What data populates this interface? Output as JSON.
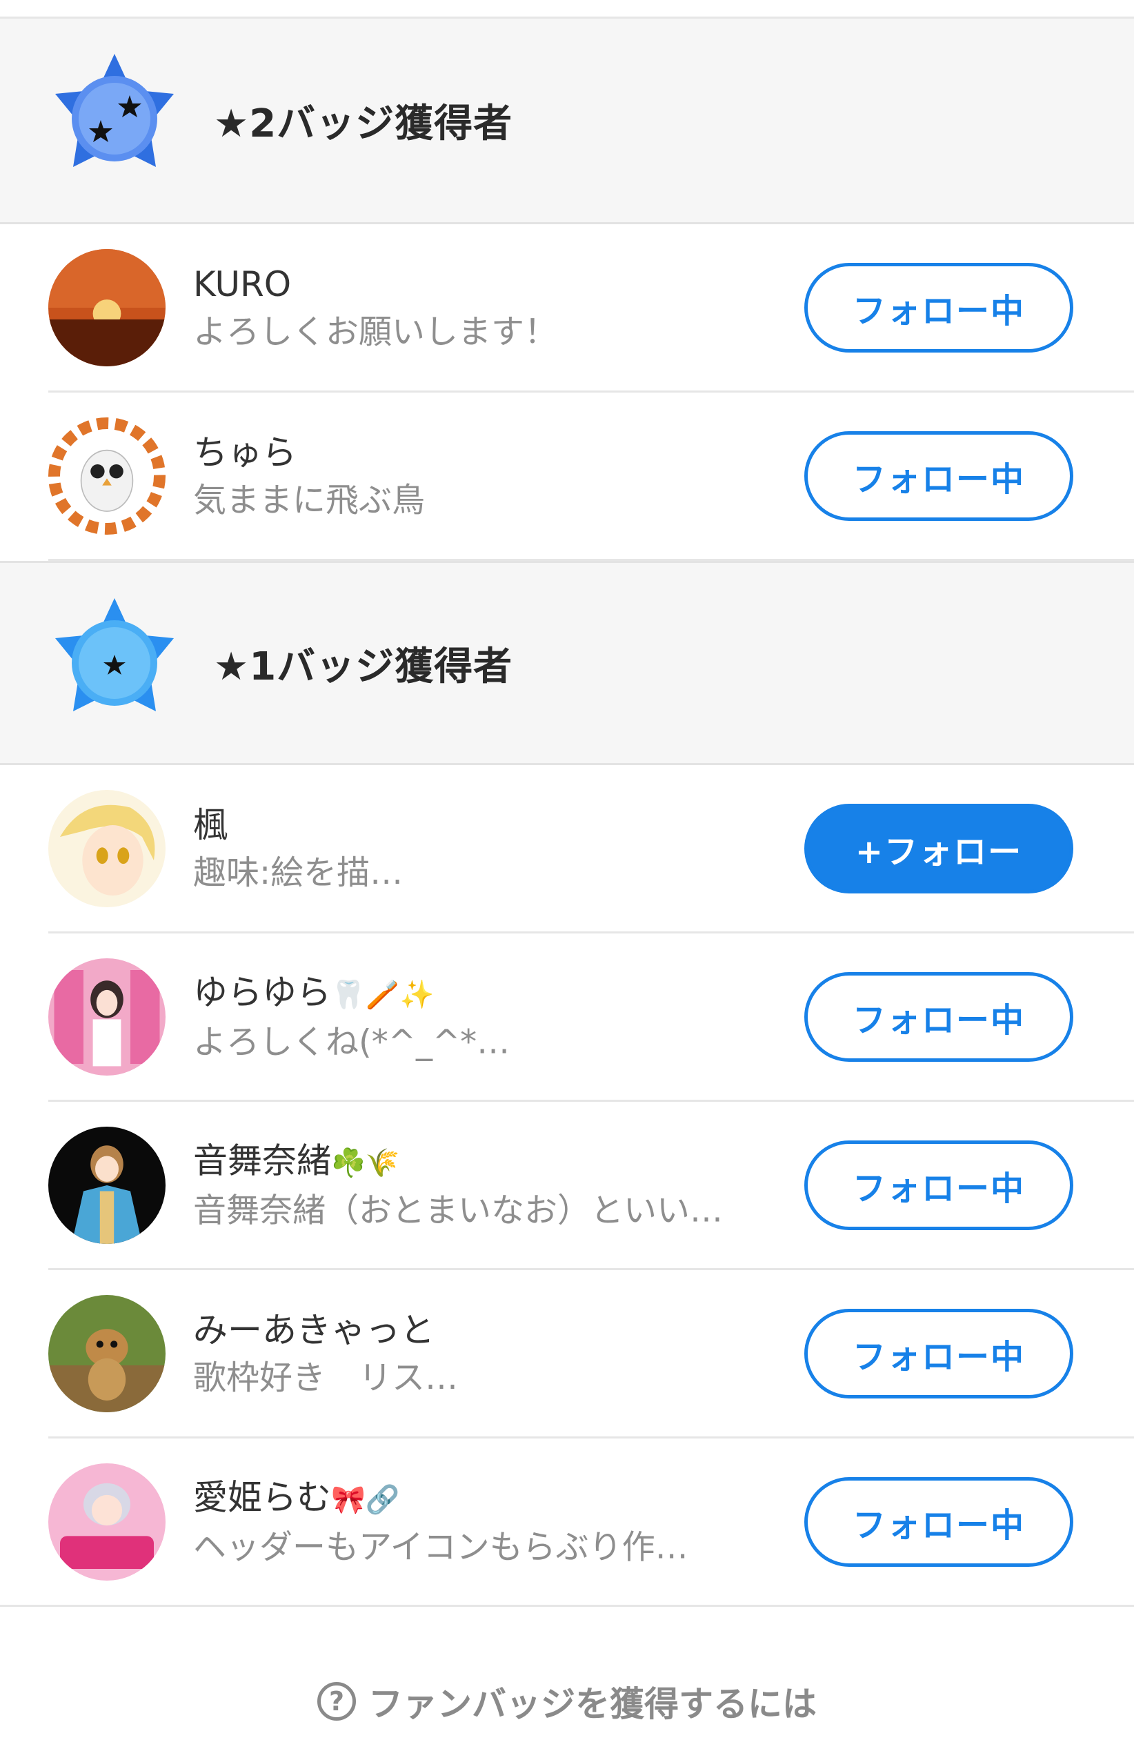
{
  "sections": [
    {
      "title": "★2バッジ獲得者",
      "badge_icon": "two-star-badge-icon",
      "badge_color": "#3f7fe8",
      "users": [
        {
          "name": "KURO",
          "bio": "よろしくお願いします！",
          "button": "フォロー中",
          "avatar": "sunset-avatar"
        },
        {
          "name": "ちゅら",
          "bio": "気ままに飛ぶ鳥",
          "button": "フォロー中",
          "avatar": "owl-avatar"
        }
      ]
    },
    {
      "title": "★1バッジ獲得者",
      "badge_icon": "one-star-badge-icon",
      "badge_color": "#3aa0f0",
      "users": [
        {
          "name": "楓",
          "bio": "趣味:絵を描…",
          "button": "+フォロー",
          "avatar": "anime-girl-avatar"
        },
        {
          "name": "ゆらゆら",
          "name_emoji": "🦷🪥✨",
          "bio": "よろしくね(*^_^*…",
          "button": "フォロー中",
          "avatar": "pink-character-avatar"
        },
        {
          "name": "音舞奈緒",
          "name_emoji": "☘️🌾",
          "bio": "音舞奈緒（おとまいなお）といい…",
          "button": "フォロー中",
          "avatar": "kimono-character-avatar"
        },
        {
          "name": "みーあきゃっと",
          "bio": "歌枠好き　リス…",
          "button": "フォロー中",
          "avatar": "meerkat-avatar"
        },
        {
          "name": "愛姫らむ",
          "name_emoji": "🎀🔗",
          "bio": "ヘッダーもアイコンもらぶり作…",
          "button": "フォロー中",
          "avatar": "badge-poster-avatar"
        }
      ]
    }
  ],
  "footer": {
    "link_text": "ファンバッジを獲得するには",
    "icon": "question-circle-icon"
  },
  "colors": {
    "accent": "#1781e8",
    "header_bg": "#f6f6f6",
    "bio_text": "#8e8e8e"
  }
}
